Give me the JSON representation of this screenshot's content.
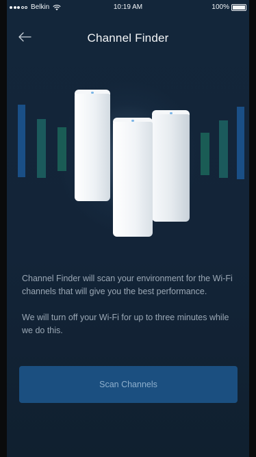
{
  "status_bar": {
    "carrier": "Belkin",
    "signal_bars_total": 5,
    "signal_bars_filled": 3,
    "time": "10:19 AM",
    "battery_text": "100%",
    "battery_level": 1.0,
    "icons": [
      "cell-signal-icon",
      "wifi-icon",
      "battery-icon"
    ]
  },
  "header": {
    "back_icon": "left-arrow-icon",
    "title": "Channel Finder"
  },
  "hero": {
    "image": "velop-mesh-nodes-illustration",
    "node_count": 3
  },
  "description": {
    "paragraph_1": "Channel Finder will scan your environment for the Wi-Fi channels that will give you the best performance.",
    "paragraph_2": "We will turn off your Wi-Fi for up to three minutes while we do this."
  },
  "actions": {
    "scan_label": "Scan Channels"
  },
  "colors": {
    "background": "#13263a",
    "button": "#1b4f80",
    "button_text": "#8fb0cd",
    "body_text": "#9ba8b5",
    "title_text": "#f4f6f8",
    "signal_bars": [
      "#1a4f86",
      "#1b5a5c",
      "#1d6a5c"
    ]
  }
}
